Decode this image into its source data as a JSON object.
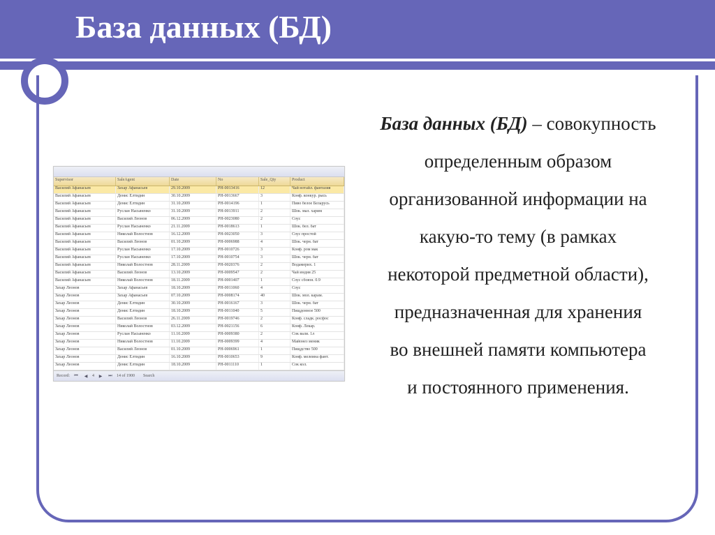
{
  "title": "База данных (БД)",
  "definition": {
    "term": "База данных (БД)",
    "text_parts": [
      " – совокупность",
      "определенным образом",
      "организованной информации на",
      "какую-то тему (в рамках",
      "некоторой предметной области),",
      "предназначенная для хранения",
      "во внешней памяти компьютера",
      "и постоянного применения."
    ]
  },
  "table": {
    "headers": [
      "Supervisor",
      "SaleAgent",
      "Date",
      "No",
      "Sale_Qty",
      "Product"
    ],
    "nav": {
      "label": "Record:",
      "pos": "4",
      "total": "14 of 1900",
      "search": "Search"
    },
    "rows": [
      {
        "sel": true,
        "c": [
          "Василий Афанасьев",
          "Захар Афанасьев",
          "29.10.2009",
          "РН-0013416",
          "12",
          "Чай нотайл. фантазия"
        ]
      },
      {
        "c": [
          "Василий Афанасьев",
          "Денис Елтидин",
          "30.10.2009",
          "РН-0013667",
          "3",
          "Конф. конкур. рысь"
        ]
      },
      {
        "c": [
          "Василий Афанасьев",
          "Денис Елтидин",
          "31.10.2009",
          "РН-0014196",
          "1",
          "Пиво белое Беларусь"
        ]
      },
      {
        "c": [
          "Василий Афанасьев",
          "Руслан Насыненко",
          "31.10.2009",
          "РН-0013911",
          "2",
          "Шок. мал. харим"
        ]
      },
      {
        "c": [
          "Василий Афанасьев",
          "Василий Леонов",
          "06.12.2009",
          "РН-0023080",
          "2",
          "Соус"
        ]
      },
      {
        "c": [
          "Василий Афанасьев",
          "Руслан Насыненко",
          "21.11.2009",
          "РН-0018613",
          "1",
          "Шок. бел. бат"
        ]
      },
      {
        "c": [
          "Василий Афанасьев",
          "Николай Волостнов",
          "16.12.2009",
          "РН-0023050",
          "3",
          "Соус простой"
        ]
      },
      {
        "c": [
          "Василий Афанасьев",
          "Василий Леонов",
          "01.10.2009",
          "РН-0006988",
          "4",
          "Шок. черн. бат"
        ]
      },
      {
        "c": [
          "Василий Афанасьев",
          "Руслан Насыненко",
          "17.10.2009",
          "РН-0010726",
          "3",
          "Конф. ром мак"
        ]
      },
      {
        "c": [
          "Василий Афанасьев",
          "Руслан Насыненко",
          "17.10.2009",
          "РН-0010754",
          "3",
          "Шок. черн. бат"
        ]
      },
      {
        "c": [
          "Василий Афанасьев",
          "Николай Волостнов",
          "28.11.2009",
          "РН-0020376",
          "2",
          "Водамерих. 1"
        ]
      },
      {
        "c": [
          "Василий Афанасьев",
          "Василий Леонов",
          "13.10.2009",
          "РН-0009547",
          "2",
          "Чай индия 25"
        ]
      },
      {
        "c": [
          "Василий Афанасьев",
          "Николай Волостнов",
          "18.11.2009",
          "РН-0001407",
          "1",
          "Соус сбоюн. 0.9"
        ]
      },
      {
        "c": [
          "Захар Леонов",
          "Захар Афанасьев",
          "18.10.2009",
          "РН-0011060",
          "4",
          "Соус"
        ]
      },
      {
        "c": [
          "Захар Леонов",
          "Захар Афанасьев",
          "07.10.2009",
          "РН-0008174",
          "40",
          "Шок. мол. карам."
        ]
      },
      {
        "c": [
          "Захар Леонов",
          "Денис Елтидин",
          "30.10.2009",
          "РН-0016167",
          "3",
          "Шок. черн. бат"
        ]
      },
      {
        "c": [
          "Захар Леонов",
          "Денис Елтидин",
          "18.10.2009",
          "РН-0011040",
          "5",
          "Пищдонное 500"
        ]
      },
      {
        "c": [
          "Захар Леонов",
          "Василий Леонов",
          "26.11.2009",
          "РН-0019746",
          "2",
          "Конф. сладк. росфос"
        ]
      },
      {
        "c": [
          "Захар Леонов",
          "Николай Волостнов",
          "03.12.2009",
          "РН-0021156",
          "6",
          "Конф. Лекар."
        ]
      },
      {
        "c": [
          "Захар Леонов",
          "Руслан Насыненко",
          "11.10.2009",
          "РН-0009380",
          "2",
          "Сок вали. 1л"
        ]
      },
      {
        "c": [
          "Захар Леонов",
          "Николай Волостнов",
          "11.10.2009",
          "РН-0009399",
          "4",
          "Майонез меник"
        ]
      },
      {
        "c": [
          "Захар Леонов",
          "Василий Леонов",
          "01.10.2009",
          "РН-0006961",
          "1",
          "Пищдство 500"
        ]
      },
      {
        "c": [
          "Захар Леонов",
          "Денис Елтидин",
          "16.10.2009",
          "РН-0010653",
          "9",
          "Конф. мелеина фант."
        ]
      },
      {
        "c": [
          "Захар Леонов",
          "Денис Елтидин",
          "18.10.2009",
          "РН-0011110",
          "1",
          "Сок кол."
        ]
      }
    ]
  }
}
